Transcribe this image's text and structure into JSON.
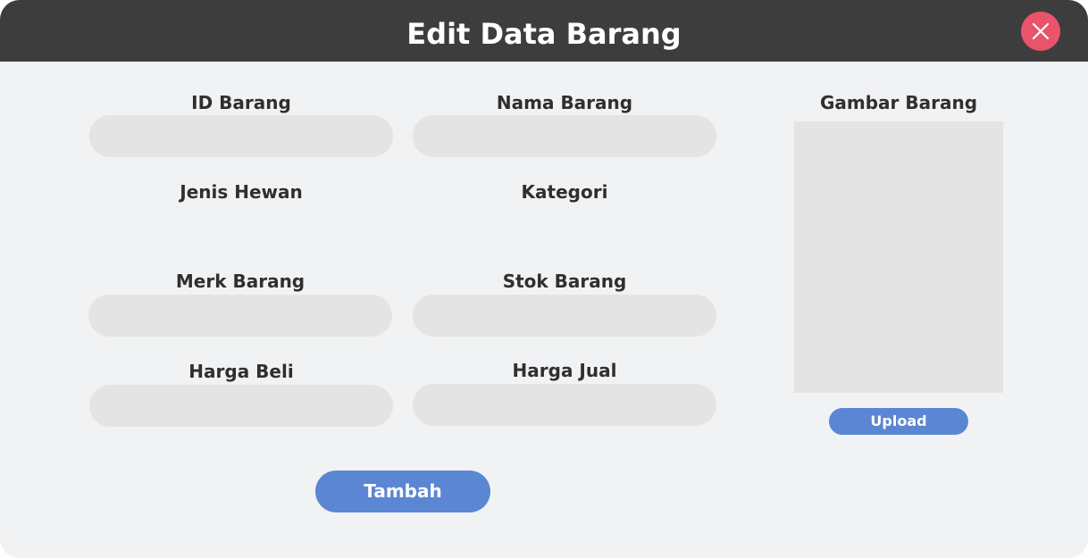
{
  "dialog": {
    "title": "Edit Data Barang"
  },
  "icons": {
    "close": "close-icon"
  },
  "colors": {
    "titlebar": "#3d3d3d",
    "close_button": "#e9536b",
    "accent": "#5b86d3",
    "input_bg": "#e4e4e4",
    "panel_bg": "#f1f2f4"
  },
  "form": {
    "id_barang": {
      "label": "ID Barang",
      "value": "",
      "placeholder": ""
    },
    "nama_barang": {
      "label": "Nama Barang",
      "value": "",
      "placeholder": ""
    },
    "jenis_hewan": {
      "label": "Jenis Hewan"
    },
    "kategori": {
      "label": "Kategori"
    },
    "merk_barang": {
      "label": "Merk Barang",
      "value": "",
      "placeholder": ""
    },
    "stok_barang": {
      "label": "Stok Barang",
      "value": "",
      "placeholder": ""
    },
    "harga_beli": {
      "label": "Harga Beli",
      "value": "",
      "placeholder": ""
    },
    "harga_jual": {
      "label": "Harga Jual",
      "value": "",
      "placeholder": ""
    }
  },
  "image_panel": {
    "label": "Gambar Barang",
    "upload_label": "Upload"
  },
  "actions": {
    "submit_label": "Tambah"
  }
}
